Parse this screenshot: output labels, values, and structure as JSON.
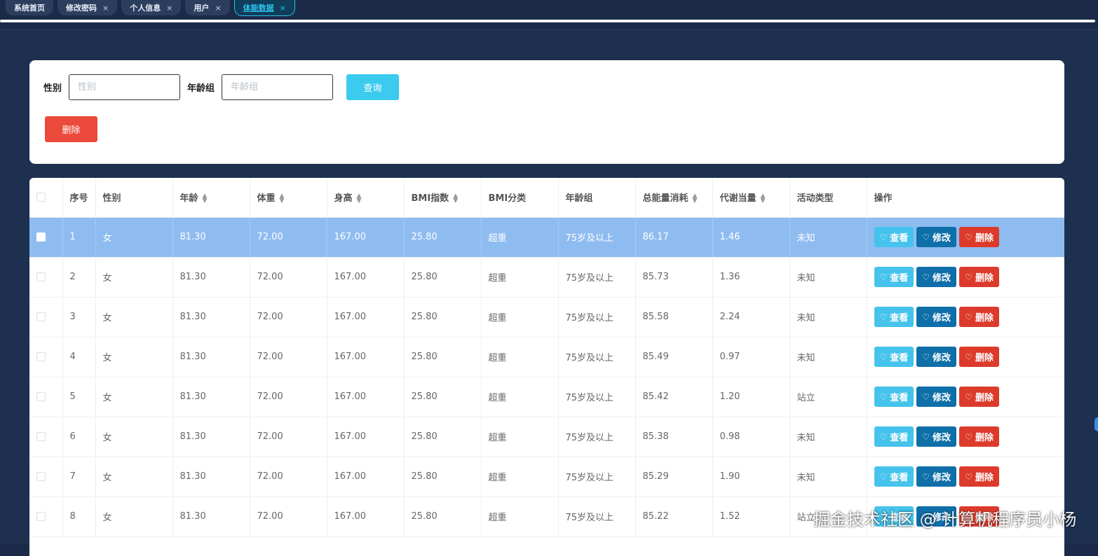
{
  "tabs": [
    {
      "label": "系统首页",
      "closable": false,
      "active": false
    },
    {
      "label": "修改密码",
      "closable": true,
      "active": false
    },
    {
      "label": "个人信息",
      "closable": true,
      "active": false
    },
    {
      "label": "用户",
      "closable": true,
      "active": false
    },
    {
      "label": "体能数据",
      "closable": true,
      "active": true
    }
  ],
  "close_glyph": "×",
  "search": {
    "gender_label": "性别",
    "gender_placeholder": "性别",
    "agegroup_label": "年龄组",
    "agegroup_placeholder": "年龄组",
    "query_button": "查询",
    "delete_button": "删除"
  },
  "table": {
    "columns": [
      "序号",
      "性别",
      "年龄",
      "体重",
      "身高",
      "BMI指数",
      "BMI分类",
      "年龄组",
      "总能量消耗",
      "代谢当量",
      "活动类型",
      "操作"
    ],
    "sortable": [
      false,
      false,
      true,
      true,
      true,
      true,
      false,
      false,
      true,
      true,
      false,
      false
    ],
    "rows": [
      [
        "1",
        "女",
        "81.30",
        "72.00",
        "167.00",
        "25.80",
        "超重",
        "75岁及以上",
        "86.17",
        "1.46",
        "未知"
      ],
      [
        "2",
        "女",
        "81.30",
        "72.00",
        "167.00",
        "25.80",
        "超重",
        "75岁及以上",
        "85.73",
        "1.36",
        "未知"
      ],
      [
        "3",
        "女",
        "81.30",
        "72.00",
        "167.00",
        "25.80",
        "超重",
        "75岁及以上",
        "85.58",
        "2.24",
        "未知"
      ],
      [
        "4",
        "女",
        "81.30",
        "72.00",
        "167.00",
        "25.80",
        "超重",
        "75岁及以上",
        "85.49",
        "0.97",
        "未知"
      ],
      [
        "5",
        "女",
        "81.30",
        "72.00",
        "167.00",
        "25.80",
        "超重",
        "75岁及以上",
        "85.42",
        "1.20",
        "站立"
      ],
      [
        "6",
        "女",
        "81.30",
        "72.00",
        "167.00",
        "25.80",
        "超重",
        "75岁及以上",
        "85.38",
        "0.98",
        "未知"
      ],
      [
        "7",
        "女",
        "81.30",
        "72.00",
        "167.00",
        "25.80",
        "超重",
        "75岁及以上",
        "85.29",
        "1.90",
        "未知"
      ],
      [
        "8",
        "女",
        "81.30",
        "72.00",
        "167.00",
        "25.80",
        "超重",
        "75岁及以上",
        "85.22",
        "1.52",
        "站立"
      ]
    ],
    "selected_row": 0,
    "actions": {
      "view": "查看",
      "edit": "修改",
      "delete": "删除"
    }
  },
  "watermark": "掘金技术社区 @ 计算机程序员小杨",
  "colors": {
    "query": "#3ccbef",
    "danger": "#ec4a3c",
    "view": "#45c3ec",
    "edit": "#0e6fa9",
    "selected_row": "#8fbcf0"
  }
}
